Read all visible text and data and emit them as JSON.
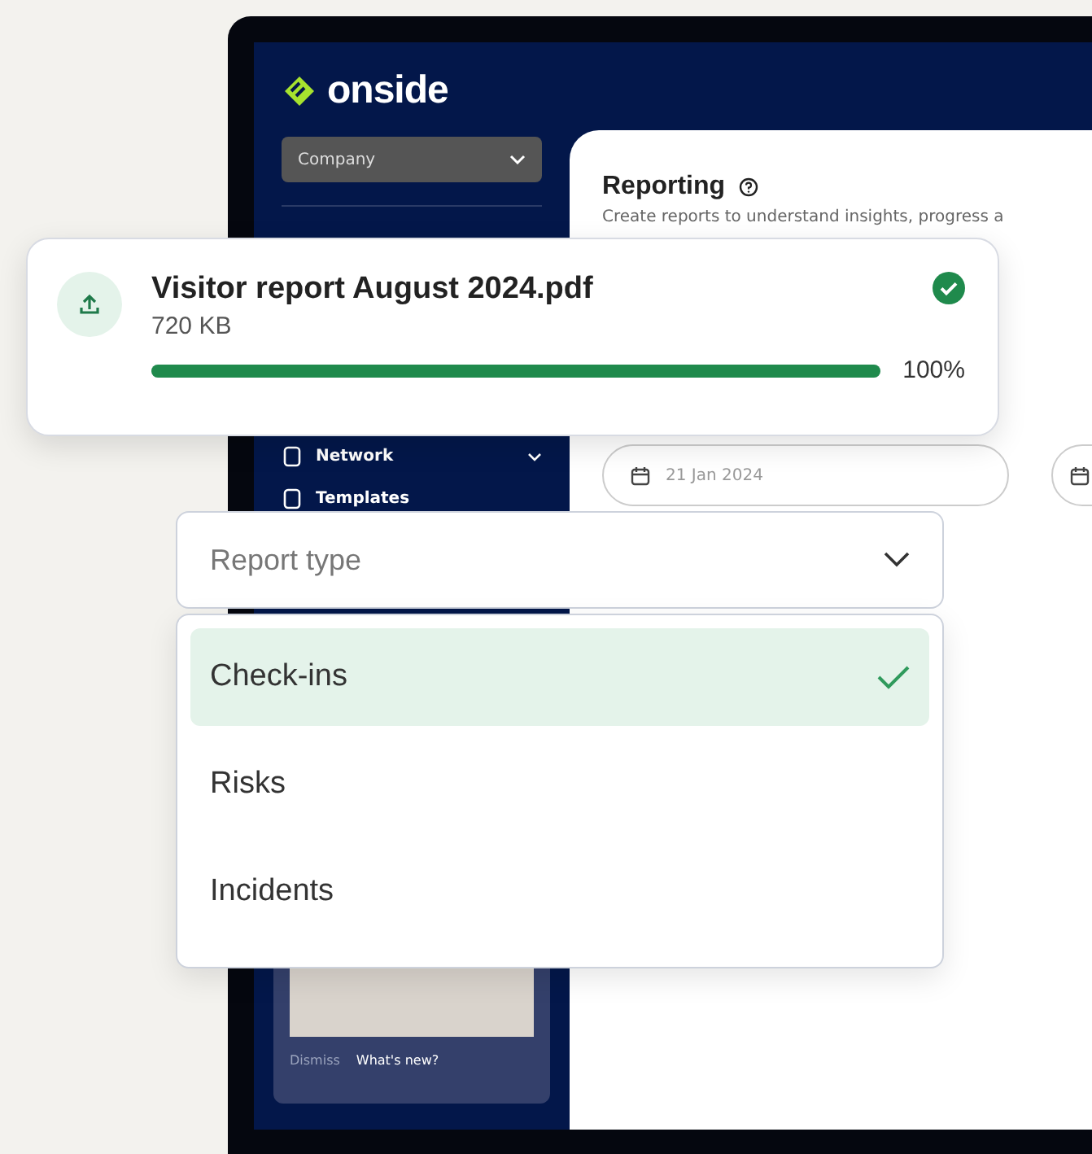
{
  "app": {
    "logo": "onside",
    "company_select": {
      "placeholder": "Company"
    },
    "nav": [
      {
        "label": "Network",
        "expandable": true
      },
      {
        "label": "Templates",
        "expandable": false
      }
    ],
    "promo": {
      "dismiss": "Dismiss",
      "link": "What's new?"
    }
  },
  "page": {
    "title": "Reporting",
    "subtitle": "Create reports to understand insights, progress a",
    "date_field": {
      "value": "21 Jan 2024"
    }
  },
  "upload": {
    "file_name": "Visitor report August 2024.pdf",
    "size": "720 KB",
    "level": 1,
    "percent": "100%",
    "complete": true
  },
  "report_type": {
    "placeholder": "Report type",
    "expanded": true,
    "options": [
      {
        "label": "Check-ins",
        "selected": true
      },
      {
        "label": "Risks",
        "selected": false
      },
      {
        "label": "Incidents",
        "selected": false
      }
    ]
  }
}
